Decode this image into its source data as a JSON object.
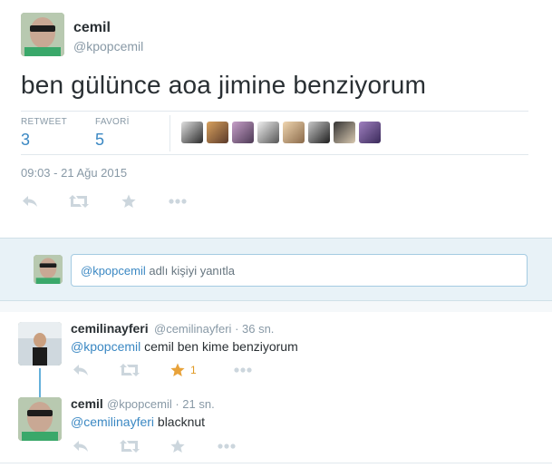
{
  "main_tweet": {
    "author_name": "cemil",
    "author_handle": "@kpopcemil",
    "text": "ben gülünce aoa jimine benziyorum",
    "stats": {
      "retweet_label": "RETWEET",
      "retweet_count": "3",
      "favorite_label": "FAVORİ",
      "favorite_count": "5"
    },
    "timestamp": "09:03 - 21 Ağu 2015"
  },
  "reply_box": {
    "mention": "@kpopcemil",
    "prompt": " adlı kişiyi yanıtla"
  },
  "replies": [
    {
      "name": "cemilinayferi",
      "handle": "@cemilinayferi",
      "time": " · 36 sn.",
      "mention": "@kpopcemil",
      "text": " cemil ben kime benziyorum",
      "favorite_count": "1"
    },
    {
      "name": "cemil",
      "handle": "@kpopcemil",
      "time": " · 21 sn.",
      "mention": "@cemilinayferi",
      "text": " blacknut",
      "favorite_count": ""
    }
  ],
  "colors": {
    "link": "#3b88c3",
    "favorited": "#e8a23a",
    "muted": "#8899a6",
    "reply_bg": "#e8f2f7"
  },
  "icons": [
    "reply-icon",
    "retweet-icon",
    "star-icon",
    "more-icon"
  ]
}
